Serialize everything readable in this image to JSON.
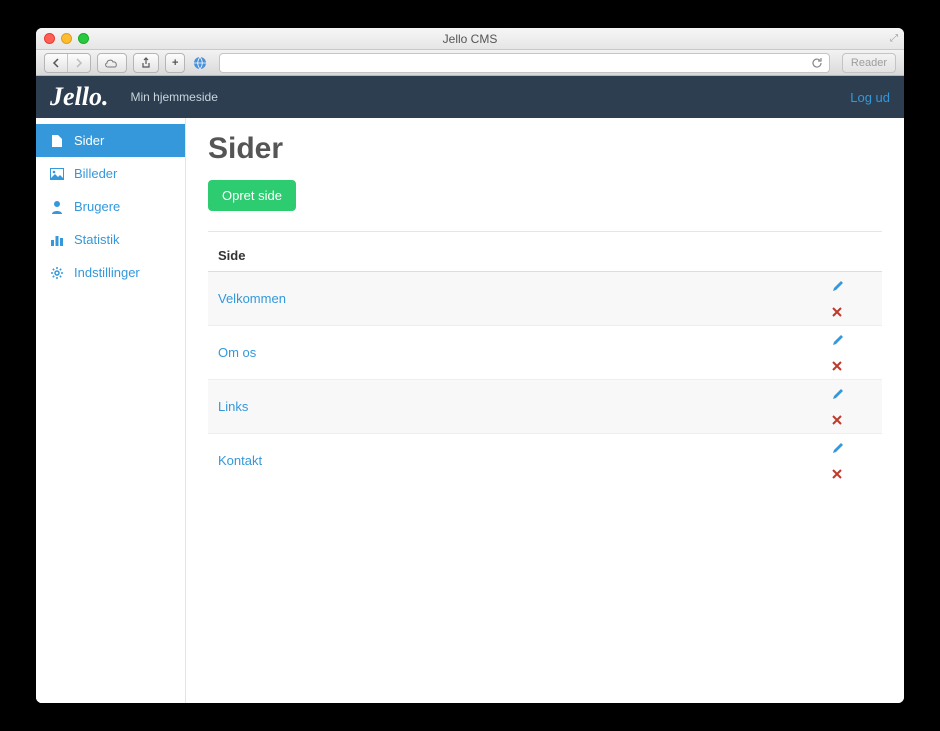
{
  "window": {
    "title": "Jello CMS"
  },
  "toolbar": {
    "reader_label": "Reader"
  },
  "navbar": {
    "brand": "Jello",
    "site_name": "Min hjemmeside",
    "logout": "Log ud"
  },
  "sidebar": {
    "items": [
      {
        "label": "Sider",
        "icon": "file-icon",
        "active": true
      },
      {
        "label": "Billeder",
        "icon": "image-icon",
        "active": false
      },
      {
        "label": "Brugere",
        "icon": "user-icon",
        "active": false
      },
      {
        "label": "Statistik",
        "icon": "chart-icon",
        "active": false
      },
      {
        "label": "Indstillinger",
        "icon": "gear-icon",
        "active": false
      }
    ]
  },
  "main": {
    "heading": "Sider",
    "create_button": "Opret side",
    "table": {
      "column_header": "Side",
      "rows": [
        {
          "title": "Velkommen"
        },
        {
          "title": "Om os"
        },
        {
          "title": "Links"
        },
        {
          "title": "Kontakt"
        }
      ]
    }
  }
}
